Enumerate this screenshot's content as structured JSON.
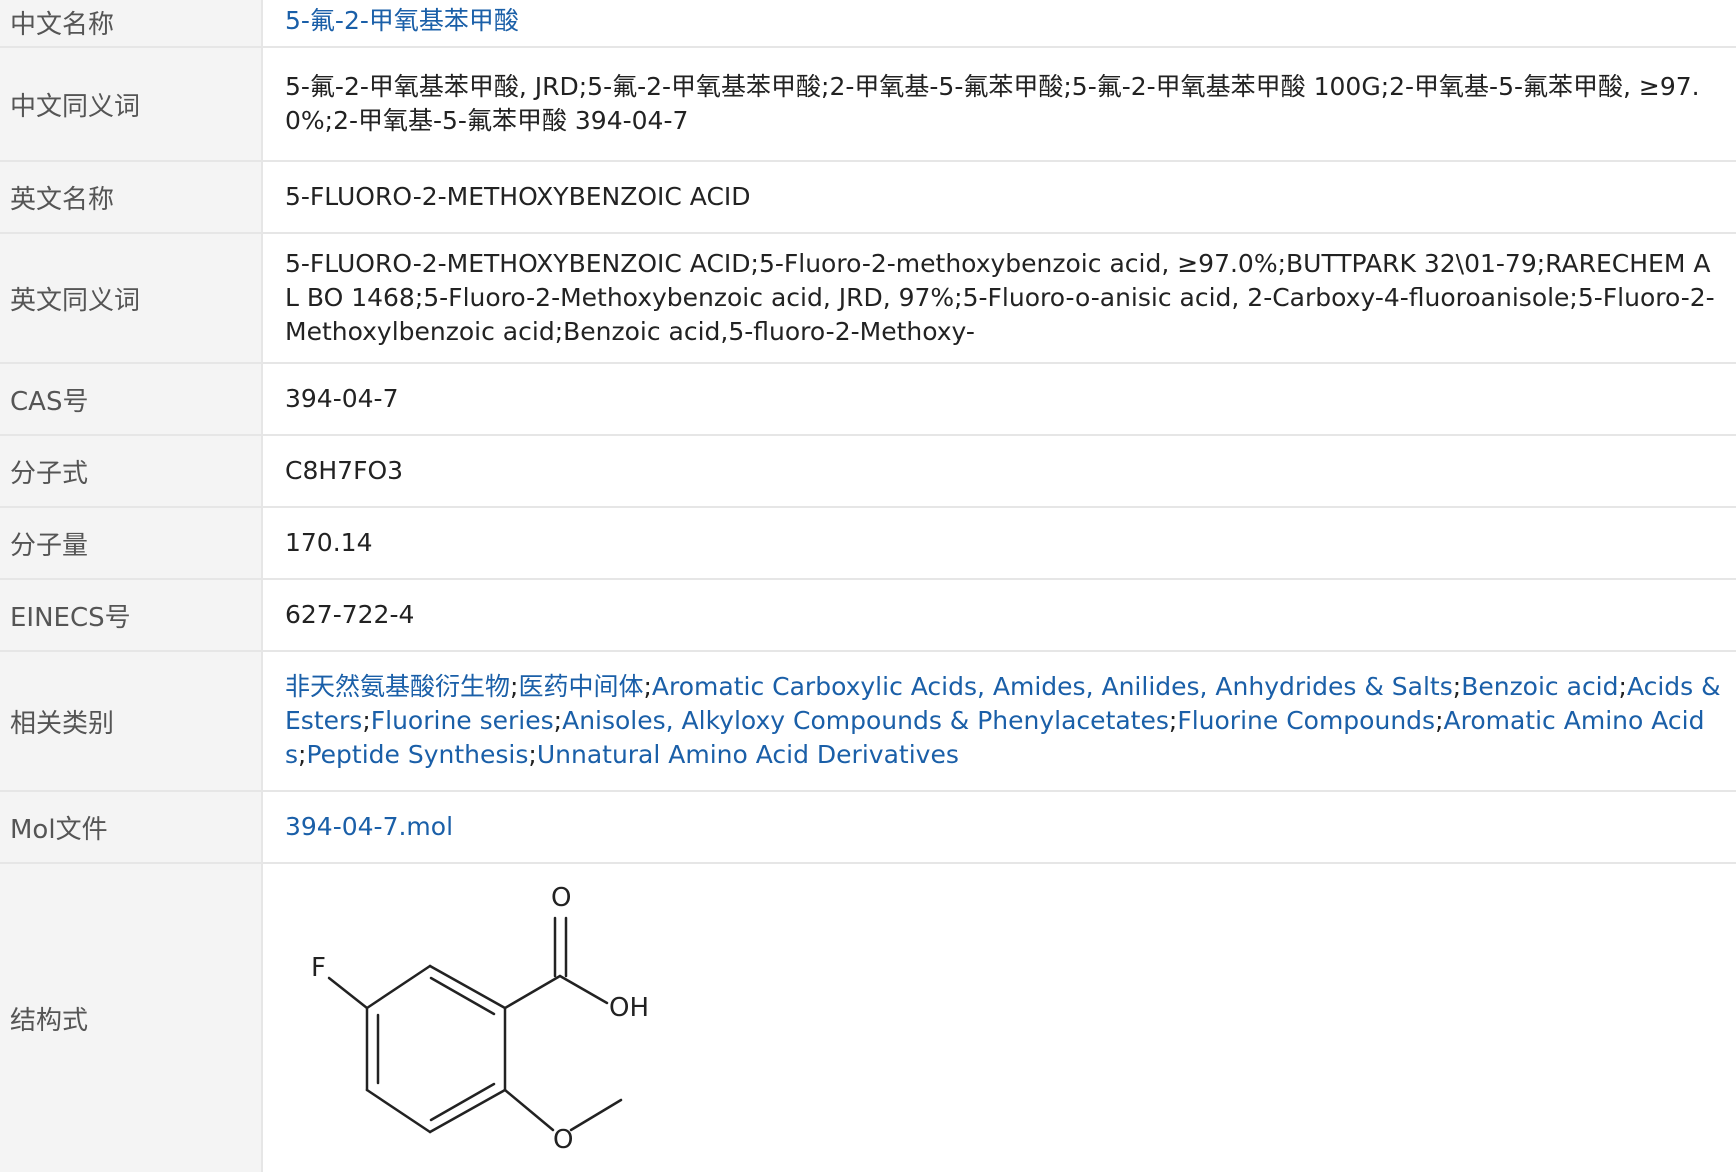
{
  "rows": {
    "chinese_name": {
      "label": "中文名称",
      "value": "5-氟-2-甲氧基苯甲酸"
    },
    "chinese_synonyms": {
      "label": "中文同义词",
      "value": "5-氟-2-甲氧基苯甲酸, JRD;5-氟-2-甲氧基苯甲酸;2-甲氧基-5-氟苯甲酸;5-氟-2-甲氧基苯甲酸 100G;2-甲氧基-5-氟苯甲酸, ≥97.0%;2-甲氧基-5-氟苯甲酸 394-04-7"
    },
    "english_name": {
      "label": "英文名称",
      "value": "5-FLUORO-2-METHOXYBENZOIC ACID"
    },
    "english_synonyms": {
      "label": "英文同义词",
      "value": "5-FLUORO-2-METHOXYBENZOIC ACID;5-Fluoro-2-methoxybenzoic acid, ≥97.0%;BUTTPARK 32\\01-79;RARECHEM AL BO 1468;5-Fluoro-2-Methoxybenzoic acid, JRD, 97%;5-Fluoro-o-anisic acid, 2-Carboxy-4-fluoroanisole;5-Fluoro-2-Methoxylbenzoic acid;Benzoic acid,5-fluoro-2-Methoxy-"
    },
    "cas": {
      "label": "CAS号",
      "value": "394-04-7"
    },
    "formula": {
      "label": "分子式",
      "value": "C8H7FO3"
    },
    "weight": {
      "label": "分子量",
      "value": "170.14"
    },
    "einecs": {
      "label": "EINECS号",
      "value": "627-722-4"
    },
    "categories": {
      "label": "相关类别",
      "items": [
        "非天然氨基酸衍生物",
        "医药中间体",
        "Aromatic Carboxylic Acids, Amides, Anilides, Anhydrides & Salts",
        "Benzoic acid",
        "Acids & Esters",
        "Fluorine series",
        "Anisoles, Alkyloxy Compounds & Phenylacetates",
        "Fluorine Compounds",
        "Aromatic Amino Acids",
        "Peptide Synthesis",
        "Unnatural Amino Acid Derivatives"
      ],
      "separator": ";"
    },
    "mol_file": {
      "label": "Mol文件",
      "value": "394-04-7.mol"
    },
    "structure": {
      "label": "结构式",
      "atoms": {
        "fluorine": "F",
        "carbonyl_oxygen": "O",
        "hydroxyl": "OH",
        "ether_oxygen": "O"
      }
    }
  },
  "colors": {
    "link": "#1a5fa8",
    "label_bg": "#f4f4f4",
    "border": "#e6e6e6"
  }
}
